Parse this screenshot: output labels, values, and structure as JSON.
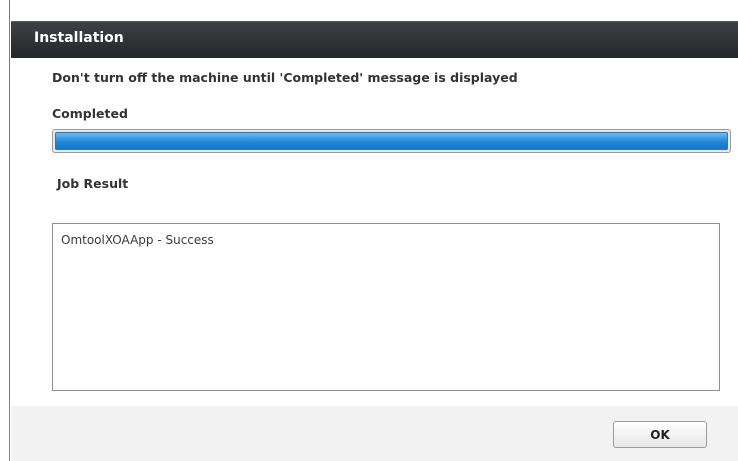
{
  "dialog": {
    "title": "Installation",
    "instruction": "Don't turn off the machine until 'Completed' message is displayed",
    "status": "Completed",
    "progress": 1.0,
    "job_result_label": "Job Result",
    "job_result_text": "OmtoolXOAApp - Success",
    "ok_label": "OK"
  },
  "colors": {
    "title_bar": "#2f3033",
    "progress_fill": "#1f86d8",
    "footer": "#f2f2f2"
  }
}
